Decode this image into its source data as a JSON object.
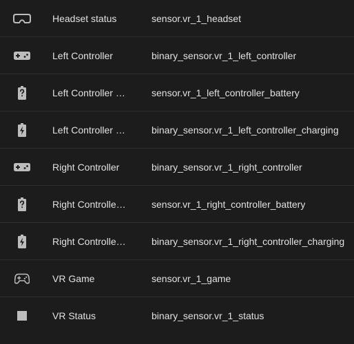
{
  "entities": [
    {
      "icon": "headset-icon",
      "name": "Headset status",
      "entity_id": "sensor.vr_1_headset"
    },
    {
      "icon": "controller-icon",
      "name": "Left Controller",
      "entity_id": "binary_sensor.vr_1_left_controller"
    },
    {
      "icon": "battery-unknown-icon",
      "name": "Left Controller Battery",
      "entity_id": "sensor.vr_1_left_controller_battery"
    },
    {
      "icon": "battery-charging-icon",
      "name": "Left Controller Charging",
      "entity_id": "binary_sensor.vr_1_left_controller_charging"
    },
    {
      "icon": "controller-icon",
      "name": "Right Controller",
      "entity_id": "binary_sensor.vr_1_right_controller"
    },
    {
      "icon": "battery-unknown-icon",
      "name": "Right Controller Battery",
      "entity_id": "sensor.vr_1_right_controller_battery"
    },
    {
      "icon": "battery-charging-icon",
      "name": "Right Controller Charging",
      "entity_id": "binary_sensor.vr_1_right_controller_charging"
    },
    {
      "icon": "gamepad-icon",
      "name": "VR Game",
      "entity_id": "sensor.vr_1_game"
    },
    {
      "icon": "square-icon",
      "name": "VR Status",
      "entity_id": "binary_sensor.vr_1_status"
    }
  ],
  "colors": {
    "background": "#1c1c1c",
    "divider": "#2f2f2f",
    "text": "#e1e1e1",
    "icon": "#bdbdbd"
  }
}
